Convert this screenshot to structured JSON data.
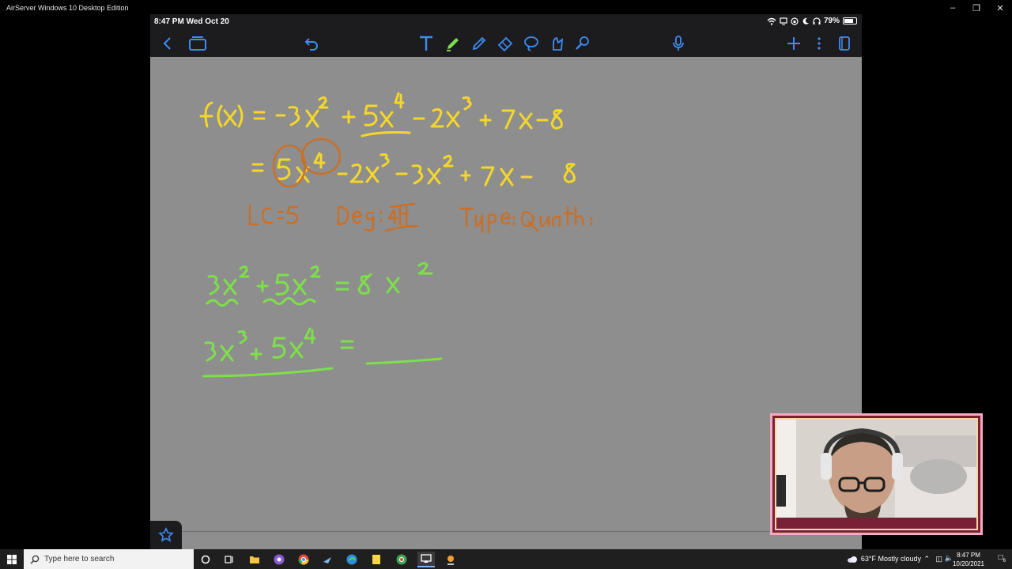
{
  "window": {
    "title": "AirServer Windows 10 Desktop Edition"
  },
  "ios_status": {
    "time_date": "8:47 PM   Wed Oct 20",
    "battery": "79%",
    "battery_level": 0.79
  },
  "toolbar_icons": [
    "back-icon",
    "documents-icon",
    "undo-icon",
    "text-tool-icon",
    "pen-icon",
    "pencil-icon",
    "eraser-icon",
    "lasso-icon",
    "shapes-icon",
    "laser-pointer-icon",
    "microphone-icon",
    "add-icon",
    "more-icon",
    "pages-icon"
  ],
  "taskbar": {
    "search_placeholder": "Type here to search",
    "weather": "63°F  Mostly cloudy",
    "clock_time": "8:47 PM",
    "clock_date": "10/20/2021",
    "notification_count": "6"
  },
  "colors": {
    "ink_yellow": "#f4d72a",
    "ink_orange": "#c8702a",
    "ink_green": "#7de04a",
    "canvas": "#8e8e8e",
    "pen_active": "#7de04a"
  }
}
